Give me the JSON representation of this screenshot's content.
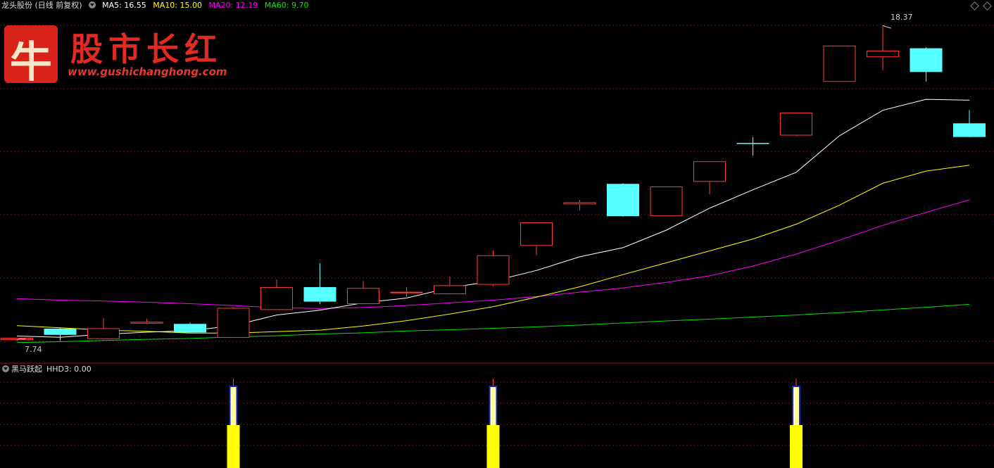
{
  "header": {
    "title": "龙头股份 (日线 前复权)",
    "ma_labels": [
      {
        "text": "MA5: 16.55",
        "color": "#ffffff"
      },
      {
        "text": "MA10: 15.00",
        "color": "#ffff00"
      },
      {
        "text": "MA20: 12.19",
        "color": "#ff00ff"
      },
      {
        "text": "MA60: 9.70",
        "color": "#00e000"
      }
    ]
  },
  "logo": {
    "char": "牛",
    "brand": "股市长红",
    "url": "www.gushichanghong.com"
  },
  "sub_header": {
    "indicator": "黑马跃起",
    "value_label": "HHD3: 0.00"
  },
  "annotations": {
    "high": "18.37",
    "low": "7.74"
  },
  "colors": {
    "up": "#ff3a3a",
    "down": "#55ffff",
    "ma5": "#ffffff",
    "ma10": "#ffff00",
    "ma20": "#ff00ff",
    "ma60": "#00e000",
    "grid": "#7a1010",
    "separator": "#aa1111",
    "signal": "#ffff00"
  },
  "chart_data": {
    "type": "candlestick",
    "price_range": [
      7.2,
      18.8
    ],
    "candles": [
      {
        "o": 7.77,
        "h": 7.84,
        "l": 7.72,
        "c": 7.84
      },
      {
        "o": 8.15,
        "h": 8.18,
        "l": 7.74,
        "c": 7.94
      },
      {
        "o": 7.8,
        "h": 8.51,
        "l": 7.78,
        "c": 8.16
      },
      {
        "o": 8.32,
        "h": 8.48,
        "l": 8.3,
        "c": 8.38
      },
      {
        "o": 8.31,
        "h": 8.35,
        "l": 8.0,
        "c": 8.02
      },
      {
        "o": 7.84,
        "h": 8.87,
        "l": 7.84,
        "c": 8.85
      },
      {
        "o": 8.78,
        "h": 9.81,
        "l": 8.78,
        "c": 9.55
      },
      {
        "o": 9.55,
        "h": 10.35,
        "l": 8.97,
        "c": 9.06
      },
      {
        "o": 8.98,
        "h": 9.76,
        "l": 8.98,
        "c": 9.52
      },
      {
        "o": 9.35,
        "h": 9.55,
        "l": 9.22,
        "c": 9.39
      },
      {
        "o": 9.31,
        "h": 9.91,
        "l": 9.31,
        "c": 9.61
      },
      {
        "o": 9.63,
        "h": 10.79,
        "l": 9.58,
        "c": 10.62
      },
      {
        "o": 10.94,
        "h": 11.73,
        "l": 10.62,
        "c": 11.73
      },
      {
        "o": 12.34,
        "h": 12.49,
        "l": 12.13,
        "c": 12.41
      },
      {
        "o": 13.03,
        "h": 13.05,
        "l": 11.92,
        "c": 11.94
      },
      {
        "o": 11.94,
        "h": 12.94,
        "l": 11.94,
        "c": 12.94
      },
      {
        "o": 13.1,
        "h": 13.8,
        "l": 12.68,
        "c": 13.79
      },
      {
        "o": 14.41,
        "h": 14.61,
        "l": 13.98,
        "c": 14.38
      },
      {
        "o": 14.66,
        "h": 15.43,
        "l": 14.65,
        "c": 15.43
      },
      {
        "o": 16.47,
        "h": 17.69,
        "l": 16.47,
        "c": 17.69
      },
      {
        "o": 17.3,
        "h": 18.37,
        "l": 16.86,
        "c": 17.52
      },
      {
        "o": 17.6,
        "h": 17.64,
        "l": 16.48,
        "c": 16.8
      },
      {
        "o": 15.07,
        "h": 15.52,
        "l": 14.6,
        "c": 14.61
      }
    ],
    "ma5": [
      7.9,
      7.86,
      7.96,
      8.03,
      8.08,
      8.25,
      8.61,
      8.77,
      9.02,
      9.18,
      9.53,
      9.75,
      10.11,
      10.57,
      10.88,
      11.47,
      12.21,
      12.83,
      13.42,
      14.65,
      15.51,
      15.88,
      15.85
    ],
    "ma10": [
      8.25,
      8.18,
      8.1,
      8.06,
      8.0,
      8.0,
      8.05,
      8.1,
      8.24,
      8.42,
      8.64,
      8.89,
      9.21,
      9.56,
      9.97,
      10.37,
      10.77,
      11.17,
      11.67,
      12.31,
      13.05,
      13.46,
      13.66
    ],
    "ma20": [
      9.16,
      9.11,
      9.08,
      9.04,
      8.99,
      8.93,
      8.85,
      8.83,
      8.86,
      8.93,
      9.02,
      9.11,
      9.23,
      9.38,
      9.52,
      9.71,
      9.93,
      10.26,
      10.66,
      11.13,
      11.63,
      12.07,
      12.49
    ],
    "ma60": [
      7.68,
      7.71,
      7.75,
      7.79,
      7.82,
      7.87,
      7.91,
      7.97,
      8.01,
      8.07,
      8.11,
      8.16,
      8.21,
      8.27,
      8.34,
      8.41,
      8.47,
      8.54,
      8.61,
      8.69,
      8.78,
      8.87,
      8.97
    ],
    "signal_indices": [
      5,
      11,
      18
    ]
  }
}
